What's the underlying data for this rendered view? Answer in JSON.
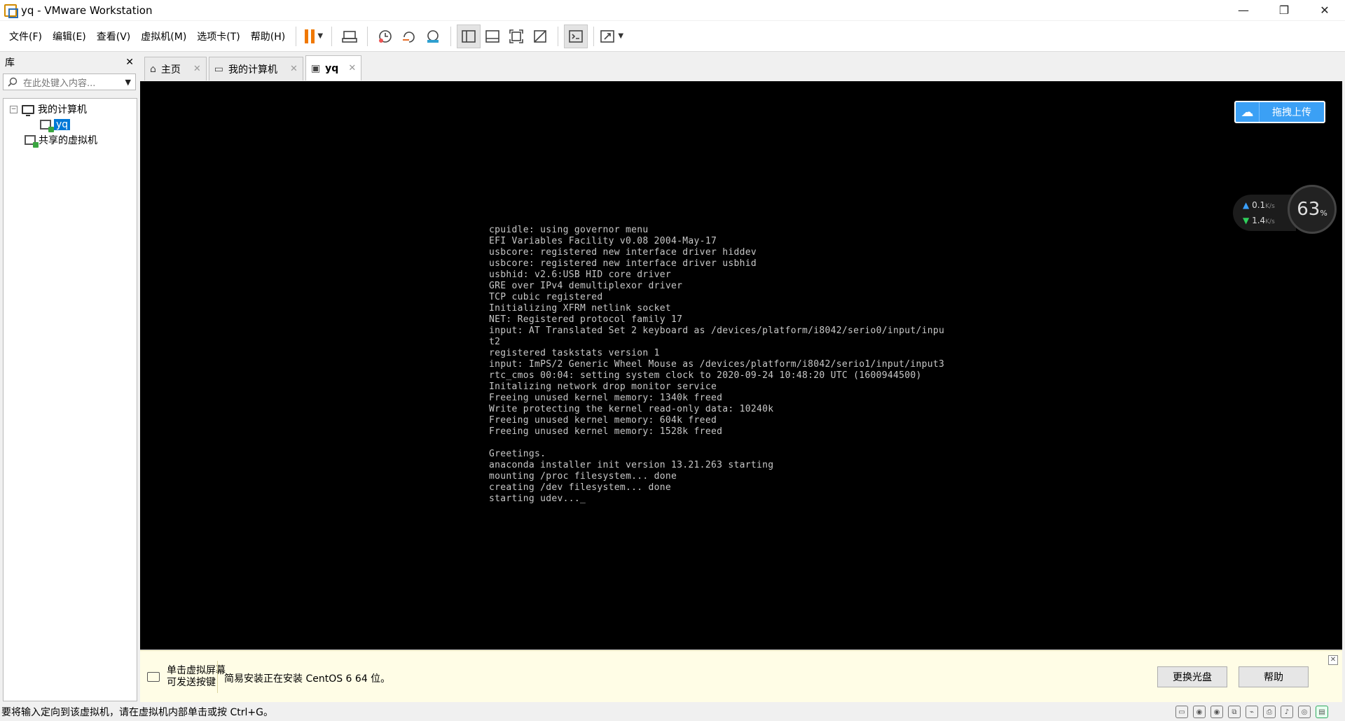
{
  "window": {
    "title": "yq - VMware Workstation",
    "controls": [
      "—",
      "❐",
      "✕"
    ]
  },
  "menu": [
    "文件(F)",
    "编辑(E)",
    "查看(V)",
    "虚拟机(M)",
    "选项卡(T)",
    "帮助(H)"
  ],
  "library": {
    "title": "库",
    "close": "✕",
    "search_placeholder": "在此处键入内容...",
    "tree": {
      "root": "我的计算机",
      "expander": "−",
      "vm": "yq",
      "shared": "共享的虚拟机"
    }
  },
  "tabs": [
    {
      "label": "主页",
      "icon": "home-icon"
    },
    {
      "label": "我的计算机",
      "icon": "monitor-icon"
    },
    {
      "label": "yq",
      "icon": "vm-icon",
      "active": true
    }
  ],
  "console_lines": [
    "cpuidle: using governor menu",
    "EFI Variables Facility v0.08 2004-May-17",
    "usbcore: registered new interface driver hiddev",
    "usbcore: registered new interface driver usbhid",
    "usbhid: v2.6:USB HID core driver",
    "GRE over IPv4 demultiplexor driver",
    "TCP cubic registered",
    "Initializing XFRM netlink socket",
    "NET: Registered protocol family 17",
    "input: AT Translated Set 2 keyboard as /devices/platform/i8042/serio0/input/inpu",
    "t2",
    "registered taskstats version 1",
    "input: ImPS/2 Generic Wheel Mouse as /devices/platform/i8042/serio1/input/input3",
    "rtc_cmos 00:04: setting system clock to 2020-09-24 10:48:20 UTC (1600944500)",
    "Initalizing network drop monitor service",
    "Freeing unused kernel memory: 1340k freed",
    "Write protecting the kernel read-only data: 10240k",
    "Freeing unused kernel memory: 604k freed",
    "Freeing unused kernel memory: 1528k freed",
    "",
    "Greetings.",
    "anaconda installer init version 13.21.263 starting",
    "mounting /proc filesystem... done",
    "creating /dev filesystem... done",
    "starting udev..._"
  ],
  "overlay": {
    "upload_label": "拖拽上传",
    "upload_speed": "0.1",
    "download_speed": "1.4",
    "speed_unit": "K/s",
    "gauge_value": "63",
    "gauge_unit": "%"
  },
  "notice": {
    "hint_line1": "单击虚拟屏幕",
    "hint_line2": "可发送按键",
    "message": "简易安装正在安装 CentOS 6 64 位。",
    "change_disc": "更换光盘",
    "help": "帮助",
    "close": "✕"
  },
  "status": {
    "text": "要将输入定向到该虚拟机，请在虚拟机内部单击或按 Ctrl+G。"
  },
  "colors": {
    "accent": "#0078d7",
    "pause": "#f07800",
    "console_bg": "#000000",
    "console_fg": "#c8c8c8",
    "notice_bg": "#fffde6"
  }
}
